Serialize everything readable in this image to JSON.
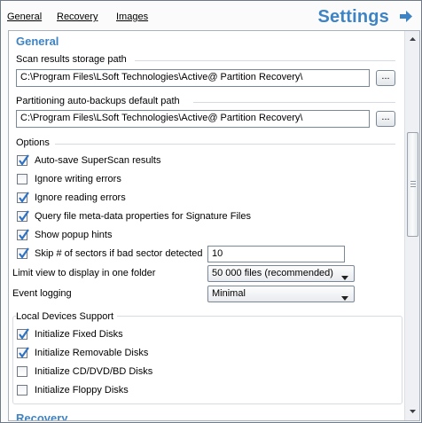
{
  "nav": {
    "general": "General",
    "recovery": "Recovery",
    "images": "Images",
    "title": "Settings"
  },
  "colors": {
    "accent": "#3e83c4",
    "check": "#2f72c4"
  },
  "general": {
    "heading": "General",
    "scan_path_label": "Scan results storage path",
    "scan_path_value": "C:\\Program Files\\LSoft Technologies\\Active@ Partition Recovery\\",
    "backup_path_label": "Partitioning auto-backups default path",
    "backup_path_value": "C:\\Program Files\\LSoft Technologies\\Active@ Partition Recovery\\",
    "browse_label": "..."
  },
  "options": {
    "heading": "Options",
    "items": [
      {
        "label": "Auto-save SuperScan results",
        "checked": true
      },
      {
        "label": "Ignore writing errors",
        "checked": false
      },
      {
        "label": "Ignore reading errors",
        "checked": true
      },
      {
        "label": "Query file meta-data properties for Signature Files",
        "checked": true
      },
      {
        "label": "Show popup hints",
        "checked": true
      },
      {
        "label": "Skip # of sectors if bad sector detected",
        "checked": true
      }
    ],
    "skip_sectors_value": "10",
    "limit_view_label": "Limit view to display in one folder",
    "limit_view_value": "50 000 files (recommended)",
    "event_logging_label": "Event logging",
    "event_logging_value": "Minimal"
  },
  "local_devices": {
    "heading": "Local Devices Support",
    "items": [
      {
        "label": "Initialize Fixed Disks",
        "checked": true
      },
      {
        "label": "Initialize Removable Disks",
        "checked": true
      },
      {
        "label": "Initialize CD/DVD/BD Disks",
        "checked": false
      },
      {
        "label": "Initialize Floppy Disks",
        "checked": false
      }
    ]
  },
  "recovery_section": {
    "heading": "Recovery"
  },
  "icons": {
    "navigate": "arrow-right-icon",
    "checkbox": "checkmark-icon",
    "dropdown": "chevron-down-icon",
    "scroll_up": "scroll-up-arrow-icon",
    "scroll_down": "scroll-down-arrow-icon"
  }
}
